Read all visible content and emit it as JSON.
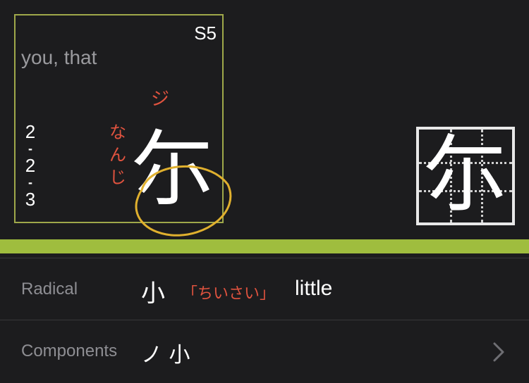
{
  "kanji": {
    "character": "尓",
    "level": "S5",
    "meaning": "you, that",
    "on_reading": "ジ",
    "kun_reading": [
      "な",
      "ん",
      "じ"
    ],
    "stroke_order": [
      "2",
      "-",
      "2",
      "-",
      "3"
    ]
  },
  "details": {
    "radical_label": "Radical",
    "radical_char": "小",
    "radical_reading": "「ちいさい」",
    "radical_meaning": "little",
    "components_label": "Components",
    "components_chars": "ノ 小"
  },
  "colors": {
    "background": "#1c1c1e",
    "card_border": "#9fa84a",
    "accent_bar": "#9fbd3e",
    "reading_red": "#e0533f",
    "circle_yellow": "#e0b02e"
  },
  "icons": {
    "chevron": "chevron-right-icon"
  }
}
